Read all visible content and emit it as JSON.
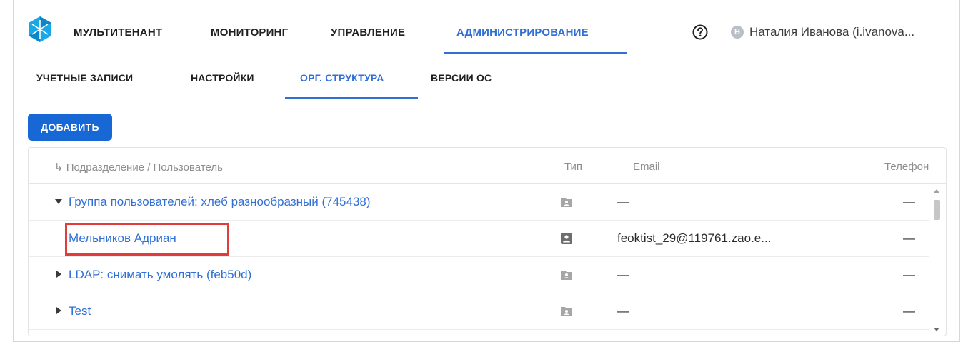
{
  "header": {
    "nav": [
      {
        "label": "МУЛЬТИТЕНАНТ"
      },
      {
        "label": "МОНИТОРИНГ"
      },
      {
        "label": "УПРАВЛЕНИЕ"
      },
      {
        "label": "АДМИНИСТРИРОВАНИЕ",
        "active": true
      }
    ],
    "user": {
      "avatar_letter": "Н",
      "name": "Наталия Иванова (i.ivanova..."
    },
    "help_icon": "help-circle-icon",
    "accent_color": "#2f6fd6"
  },
  "subtabs": [
    {
      "label": "УЧЕТНЫЕ ЗАПИСИ"
    },
    {
      "label": "НАСТРОЙКИ"
    },
    {
      "label": "ОРГ. СТРУКТУРА",
      "active": true
    },
    {
      "label": "ВЕРСИИ ОС"
    }
  ],
  "toolbar": {
    "add_label": "ДОБАВИТЬ",
    "button_color": "#1767d4"
  },
  "table": {
    "columns": {
      "name": "↳ Подразделение / Пользователь",
      "type": "Тип",
      "email": "Email",
      "phone": "Телефон"
    },
    "rows": [
      {
        "name": "Группа пользователей: хлеб разнообразный (745438)",
        "expand": "expanded",
        "type_icon": "folder-user-icon",
        "email": "—",
        "phone": "—"
      },
      {
        "name": "Мельников Адриан",
        "expand": "none",
        "type_icon": "user-card-icon",
        "email": "feoktist_29@119761.zao.e...",
        "phone": "—",
        "highlighted": true
      },
      {
        "name": "LDAP: снимать умолять (feb50d)",
        "expand": "collapsed",
        "type_icon": "folder-user-icon",
        "email": "—",
        "phone": "—"
      },
      {
        "name": "Test",
        "expand": "collapsed",
        "type_icon": "folder-user-icon",
        "email": "—",
        "phone": "—"
      }
    ]
  }
}
